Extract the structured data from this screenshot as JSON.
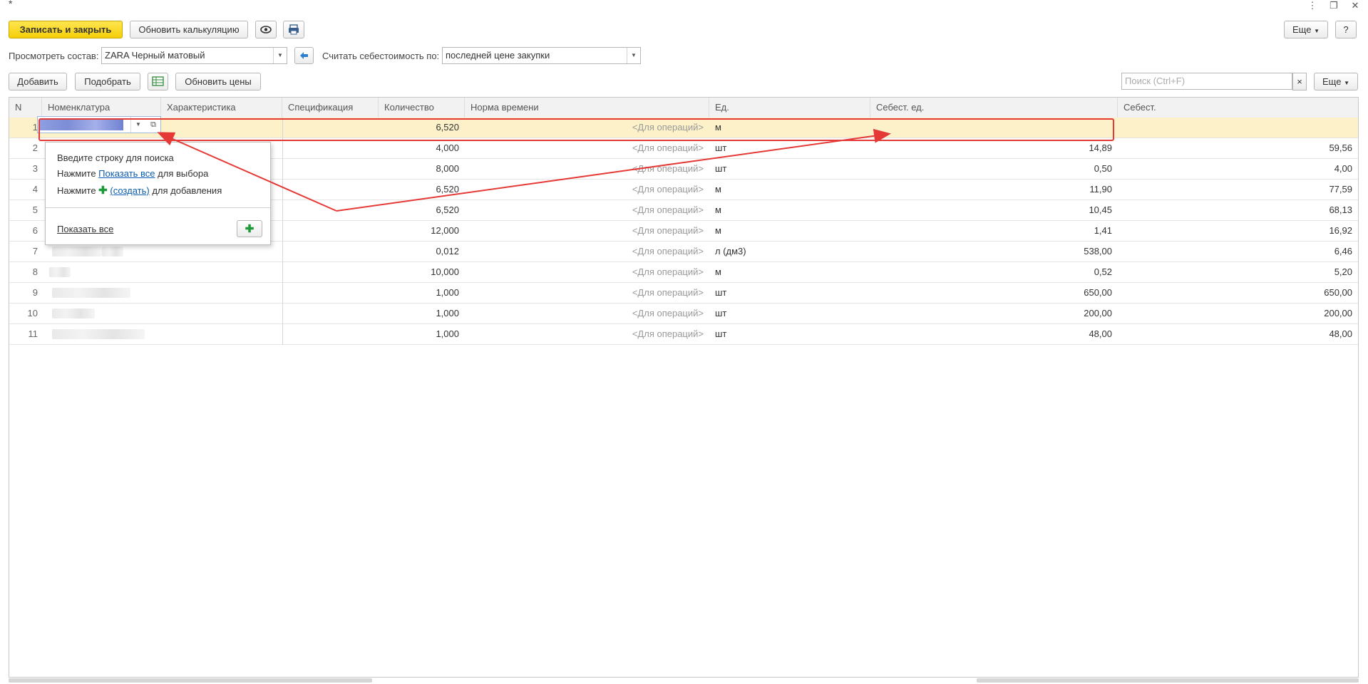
{
  "window": {
    "title_mark": "*",
    "more_icon": "⋮",
    "restore_icon": "❐",
    "close_icon": "✕"
  },
  "toolbar": {
    "save_close": "Записать и закрыть",
    "refresh_calc": "Обновить калькуляцию",
    "more": "Еще",
    "help": "?"
  },
  "filter": {
    "view_label": "Просмотреть состав:",
    "view_value": "ZARA Черный матовый",
    "cost_label": "Считать себестоимость по:",
    "cost_value": "последней цене закупки"
  },
  "table_toolbar": {
    "add": "Добавить",
    "pick": "Подобрать",
    "refresh_prices": "Обновить цены",
    "search_placeholder": "Поиск (Ctrl+F)",
    "clear": "×",
    "more": "Еще"
  },
  "columns": [
    "N",
    "Номенклатура",
    "Характеристика",
    "Спецификация",
    "Количество",
    "Норма времени",
    "Ед.",
    "Себест. ед.",
    "Себест."
  ],
  "rows": [
    {
      "n": "1",
      "qty": "6,520",
      "norm": "<Для операций>",
      "unit": "м",
      "unit_cost": "",
      "cost": ""
    },
    {
      "n": "2",
      "qty": "4,000",
      "norm": "<Для операций>",
      "unit": "шт",
      "unit_cost": "14,89",
      "cost": "59,56"
    },
    {
      "n": "3",
      "qty": "8,000",
      "norm": "<Для операций>",
      "unit": "шт",
      "unit_cost": "0,50",
      "cost": "4,00"
    },
    {
      "n": "4",
      "qty": "6,520",
      "norm": "<Для операций>",
      "unit": "м",
      "unit_cost": "11,90",
      "cost": "77,59"
    },
    {
      "n": "5",
      "qty": "6,520",
      "norm": "<Для операций>",
      "unit": "м",
      "unit_cost": "10,45",
      "cost": "68,13"
    },
    {
      "n": "6",
      "qty": "12,000",
      "norm": "<Для операций>",
      "unit": "м",
      "unit_cost": "1,41",
      "cost": "16,92"
    },
    {
      "n": "7",
      "qty": "0,012",
      "norm": "<Для операций>",
      "unit": "л (дм3)",
      "unit_cost": "538,00",
      "cost": "6,46"
    },
    {
      "n": "8",
      "qty": "10,000",
      "norm": "<Для операций>",
      "unit": "м",
      "unit_cost": "0,52",
      "cost": "5,20"
    },
    {
      "n": "9",
      "qty": "1,000",
      "norm": "<Для операций>",
      "unit": "шт",
      "unit_cost": "650,00",
      "cost": "650,00"
    },
    {
      "n": "10",
      "qty": "1,000",
      "norm": "<Для операций>",
      "unit": "шт",
      "unit_cost": "200,00",
      "cost": "200,00"
    },
    {
      "n": "11",
      "qty": "1,000",
      "norm": "<Для операций>",
      "unit": "шт",
      "unit_cost": "48,00",
      "cost": "48,00"
    }
  ],
  "popup": {
    "line1": "Введите строку для поиска",
    "line2_pre": "Нажмите ",
    "line2_link": "Показать все",
    "line2_post": " для выбора",
    "line3_pre": "Нажмите ",
    "line3_link": "(создать)",
    "line3_post": " для добавления",
    "show_all": "Показать все",
    "plus": "✚"
  },
  "colors": {
    "primary": "#f4cf07",
    "selected_row": "#fcf1c9",
    "annotation": "#e53935",
    "link": "#0c5cad"
  }
}
